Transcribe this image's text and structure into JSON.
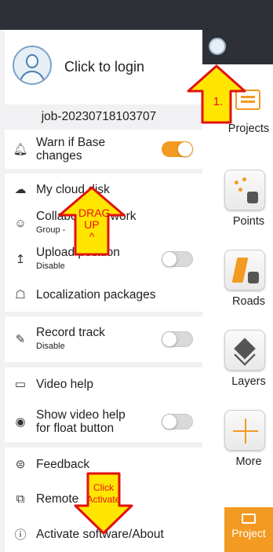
{
  "login": {
    "label": "Click to login"
  },
  "job": {
    "name": "job-20230718103707"
  },
  "menu": {
    "warn_base": {
      "label": "Warn if Base",
      "label2": "changes",
      "enabled": true
    },
    "cloud_disk": {
      "label": "My cloud disk"
    },
    "collab": {
      "label": "Collaborative work",
      "sub": "Group -"
    },
    "upload": {
      "label": "Upload position",
      "sub": "Disable",
      "enabled": false
    },
    "localization": {
      "label": "Localization packages"
    },
    "record": {
      "label": "Record track",
      "sub": "Disable",
      "enabled": false
    },
    "video_help": {
      "label": "Video help"
    },
    "show_video": {
      "label": "Show video help",
      "label2": "for float button",
      "enabled": false
    },
    "feedback": {
      "label": "Feedback"
    },
    "remote": {
      "label": "Remote"
    },
    "activate": {
      "label": "Activate software/About"
    }
  },
  "rail": {
    "projects": "Projects",
    "points": "Points",
    "roads": "Roads",
    "layers": "Layers",
    "more": "More",
    "project": "Project"
  },
  "annotations": {
    "step1": "1.",
    "drag_line1": "DRAG",
    "drag_line2": "UP",
    "drag_line3": "^",
    "click_line1": "Click",
    "click_line2": "Activate"
  },
  "colors": {
    "accent": "#f39a22",
    "arrow_fill": "#ffe600",
    "arrow_stroke": "#e11111",
    "dark": "#2d3137"
  }
}
